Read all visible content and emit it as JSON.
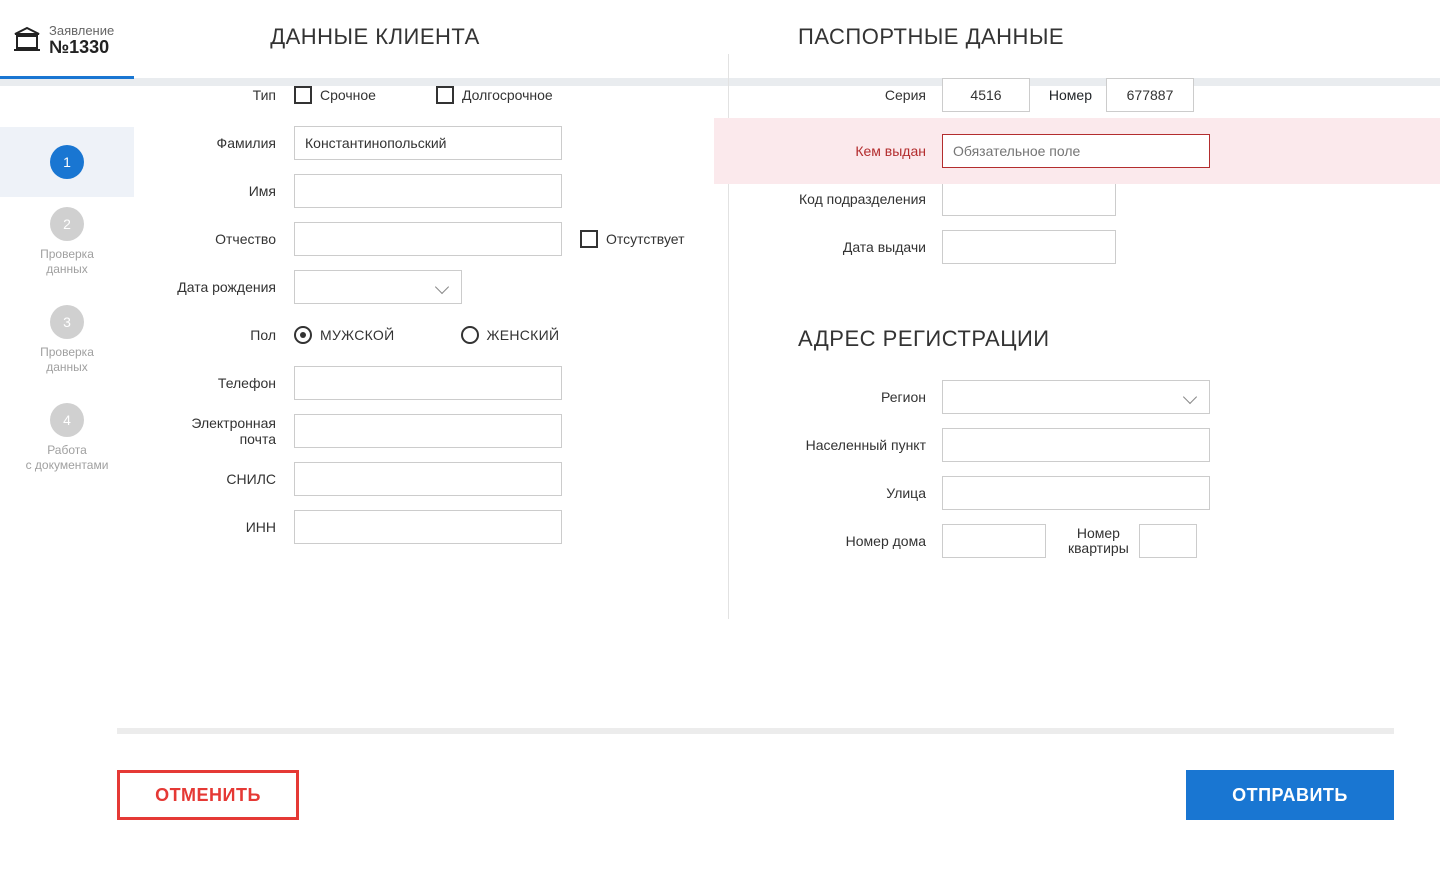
{
  "sidebar": {
    "app_label": "Заявление",
    "app_number": "№1330",
    "steps": [
      {
        "num": "1",
        "label": "",
        "active": true
      },
      {
        "num": "2",
        "label": "Проверка\nданных",
        "active": false
      },
      {
        "num": "3",
        "label": "Проверка\nданных",
        "active": false
      },
      {
        "num": "4",
        "label": "Работа\nс документами",
        "active": false
      }
    ]
  },
  "client": {
    "section_title": "ДАННЫЕ КЛИЕНТА",
    "type_label": "Тип",
    "type_urgent": "Срочное",
    "type_long": "Долгосрочное",
    "lastname_label": "Фамилия",
    "lastname_value": "Константинопольский",
    "firstname_label": "Имя",
    "firstname_value": "",
    "patronymic_label": "Отчество",
    "patronymic_value": "",
    "absent_label": "Отсутствует",
    "dob_label": "Дата рождения",
    "gender_label": "Пол",
    "gender_male": "МУЖСКОЙ",
    "gender_female": "ЖЕНСКИЙ",
    "phone_label": "Телефон",
    "phone_value": "",
    "email_label": "Электронная почта",
    "email_value": "",
    "snils_label": "СНИЛС",
    "snils_value": "",
    "inn_label": "ИНН",
    "inn_value": ""
  },
  "passport": {
    "section_title": "ПАСПОРТНЫЕ ДАННЫЕ",
    "series_label": "Серия",
    "series_value": "4516",
    "number_label": "Номер",
    "number_value": "677887",
    "issued_label": "Кем выдан",
    "issued_placeholder": "Обязательное поле",
    "issued_value": "",
    "dept_label": "Код подразделения",
    "dept_value": "",
    "issue_date_label": "Дата выдачи",
    "issue_date_value": ""
  },
  "address": {
    "section_title": "АДРЕС РЕГИСТРАЦИИ",
    "region_label": "Регион",
    "locality_label": "Населенный пункт",
    "locality_value": "",
    "street_label": "Улица",
    "street_value": "",
    "house_label": "Номер дома",
    "house_value": "",
    "apt_label": "Номер\nквартиры",
    "apt_value": ""
  },
  "footer": {
    "cancel": "ОТМЕНИТЬ",
    "submit": "ОТПРАВИТЬ"
  }
}
